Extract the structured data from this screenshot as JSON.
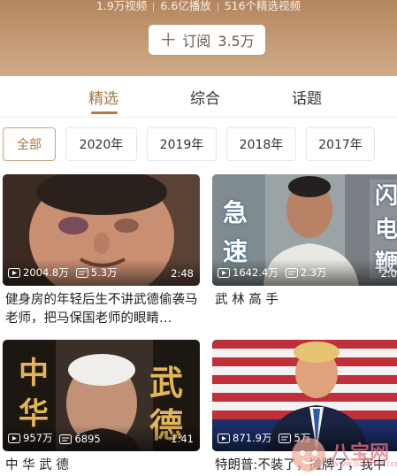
{
  "header": {
    "stats": [
      "1.9万视频",
      "6.6亿播放",
      "516个精选视频"
    ],
    "subscribe_label": "订阅",
    "subscribe_count": "3.5万"
  },
  "tabs": [
    {
      "label": "精选",
      "active": true
    },
    {
      "label": "综合",
      "active": false
    },
    {
      "label": "话题",
      "active": false
    }
  ],
  "filters": [
    {
      "label": "全部",
      "active": true
    },
    {
      "label": "2020年",
      "active": false
    },
    {
      "label": "2019年",
      "active": false
    },
    {
      "label": "2018年",
      "active": false
    },
    {
      "label": "2017年",
      "active": false
    }
  ],
  "videos": [
    {
      "plays": "2004.8万",
      "comments": "5.3万",
      "duration": "2:48",
      "title": "健身房的年轻后生不讲武德偷袭马老师，把马保国老师的眼睛…"
    },
    {
      "plays": "1642.4万",
      "comments": "2.3万",
      "duration": "2:0",
      "title": "武 林 高 手",
      "thumb_text": [
        "急",
        "速",
        "闪",
        "电",
        "鞭"
      ]
    },
    {
      "plays": "957万",
      "comments": "6895",
      "duration": "1:41",
      "title": "中 华 武 德",
      "thumb_text": [
        "中",
        "华",
        "武",
        "德"
      ]
    },
    {
      "plays": "871.9万",
      "comments": "5万",
      "duration": "",
      "title": "特朗普:不装了，摊牌了，我中"
    }
  ],
  "watermark": {
    "text": "八宝网",
    "url": "www.baqima.com"
  },
  "colors": {
    "accent": "#a8773f",
    "hero": "#c49b76"
  }
}
